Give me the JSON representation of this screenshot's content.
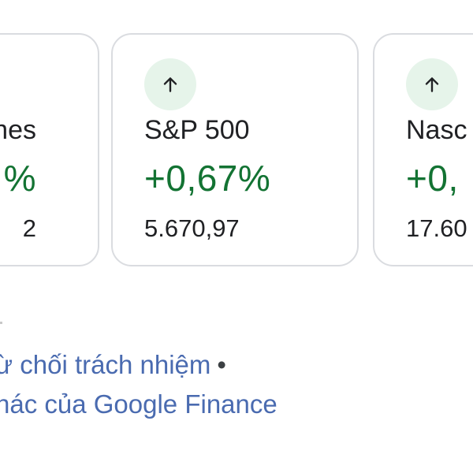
{
  "colors": {
    "positive": "#137333",
    "badge_bg": "#e6f4ea",
    "card_border": "#dadce0",
    "link": "#4a6bb0"
  },
  "cards": [
    {
      "name": "nes",
      "change": "%",
      "value": "2",
      "icon": "arrow-up-icon"
    },
    {
      "name": "S&P 500",
      "change": "+0,67%",
      "value": "5.670,97",
      "icon": "arrow-up-icon"
    },
    {
      "name": "Nasc",
      "change": "+0,",
      "value": "17.60",
      "icon": "arrow-up-icon"
    }
  ],
  "footer": {
    "disclaimer_link": "ừ chối trách nhiệm",
    "separator": "•",
    "other_link": "hác của Google Finance"
  }
}
